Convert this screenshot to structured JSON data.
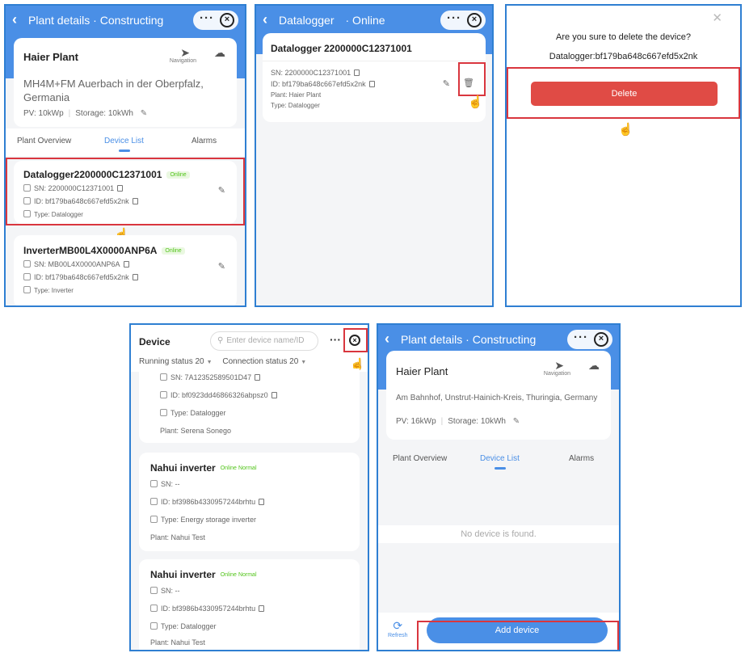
{
  "colors": {
    "primary": "#4a8fe6",
    "danger": "#e04b45",
    "highlight": "#d9363e",
    "online": "#52c41a"
  },
  "icons": {
    "back": "chevron-left-icon",
    "more": "more-dots-icon",
    "close": "close-circle-icon",
    "navigation": "navigation-arrow-icon",
    "cloud": "cloud-icon",
    "edit": "edit-icon",
    "delete": "trash-icon",
    "copy": "copy-icon",
    "hand": "pointer-hand-icon"
  },
  "panel1": {
    "header_title": "Plant details · Constructing",
    "plant_name": "Haier Plant",
    "navigation_label": "Navigation",
    "address": "MH4M+FM Auerbach in der Oberpfalz, Germania",
    "pv": "PV: 10kWp",
    "storage": "Storage: 10kWh",
    "tabs": [
      "Plant Overview",
      "Device List",
      "Alarms"
    ],
    "devices": [
      {
        "name": "Datalogger2200000C12371001",
        "status": "Online",
        "sn": "SN: 2200000C12371001",
        "id": "ID: bf179ba648c667efd5x2nk",
        "type": "Type: Datalogger"
      },
      {
        "name": "InverterMB00L4X0000ANP6A",
        "status": "Online",
        "sn": "SN: MB00L4X0000ANP6A",
        "id": "ID: bf179ba648c667efd5x2nk",
        "type": "Type: Inverter"
      }
    ]
  },
  "panel2": {
    "header_title": "Datalogger",
    "header_status": "· Online",
    "title": "Datalogger 2200000C12371001",
    "sn": "SN: 2200000C12371001",
    "id": "ID: bf179ba648c667efd5x2nk",
    "plant": "Plant:  Haier Plant",
    "type": "Type: Datalogger"
  },
  "panel3": {
    "question": "Are you sure to delete the device?",
    "device": "Datalogger:bf179ba648c667efd5x2nk",
    "delete_label": "Delete"
  },
  "panel4": {
    "title": "Device",
    "search_placeholder": "Enter device name/ID",
    "filter_running": "Running status 20",
    "filter_connection": "Connection status 20",
    "partial_card": {
      "sn": "SN: 7A12352589501D47",
      "id": "ID: bf0923dd46866326abpsz0",
      "type": "Type: Datalogger",
      "plant": "Plant:  Serena Sonego"
    },
    "cards": [
      {
        "name": "Nahui inverter",
        "status": "Online",
        "health": "Normal",
        "sn": "SN: --",
        "id": "ID: bf3986b4330957244brhtu",
        "type": "Type: Energy storage inverter",
        "plant": "Plant:  Nahui Test"
      },
      {
        "name": "Nahui inverter",
        "status": "Online",
        "health": "Normal",
        "sn": "SN: --",
        "id": "ID: bf3986b4330957244brhtu",
        "type": "Type: Datalogger",
        "plant": "Plant:  Nahui Test"
      }
    ]
  },
  "panel5": {
    "header_title": "Plant details · Constructing",
    "plant_name": "Haier Plant",
    "navigation_label": "Navigation",
    "address": "Am Bahnhof, Unstrut-Hainich-Kreis, Thuringia, Germany",
    "pv": "PV: 16kWp",
    "storage": "Storage: 10kWh",
    "tabs": [
      "Plant Overview",
      "Device List",
      "Alarms"
    ],
    "empty_text": "No device is found.",
    "refresh_label": "Refresh",
    "add_label": "Add device"
  }
}
